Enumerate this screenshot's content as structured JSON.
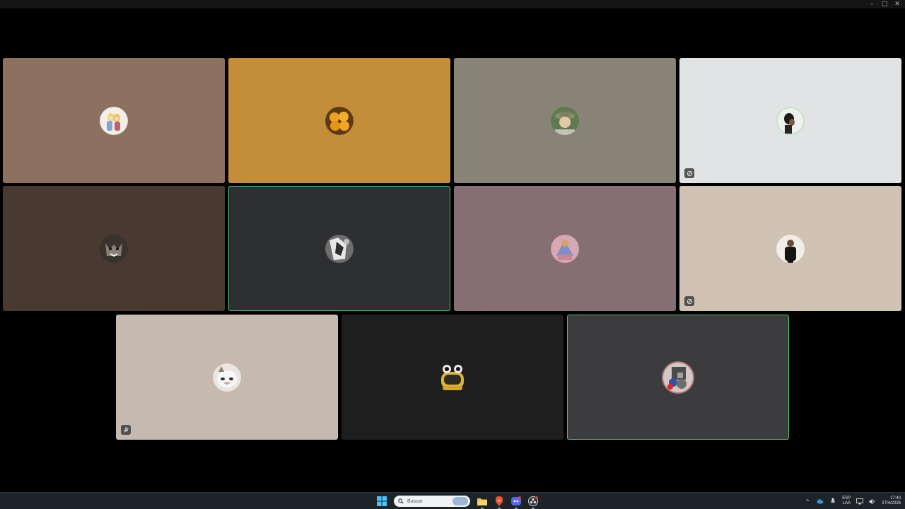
{
  "window": {
    "minimize_glyph": "–",
    "maximize_glyph": "□",
    "close_glyph": "✕"
  },
  "tiles": [
    {
      "bg": "#8c7161",
      "speaking": false,
      "avatar": "character-art"
    },
    {
      "bg": "#c48d3a",
      "speaking": false,
      "avatar": "oranges"
    },
    {
      "bg": "#878477",
      "speaking": false,
      "avatar": "person-hat"
    },
    {
      "bg": "#e2e3e4",
      "speaking": false,
      "avatar": "person-profile",
      "badge": "activity-icon"
    },
    {
      "bg": "#483a31",
      "speaking": false,
      "avatar": "wolf"
    },
    {
      "bg": "#2d2f32",
      "speaking": true,
      "avatar": "bw-animal"
    },
    {
      "bg": "#856f74",
      "speaking": false,
      "avatar": "pink-figure"
    },
    {
      "bg": "#d0c3b4",
      "speaking": false,
      "avatar": "person-dark-shirt",
      "badge": "activity-icon"
    },
    {
      "bg": "#c6bab0",
      "speaking": false,
      "avatar": "white-cat",
      "badge": "muted-mic-icon"
    },
    {
      "bg": "#1f1e1e",
      "speaking": false,
      "avatar": "yellow-frog"
    },
    {
      "bg": "#3c3c3f",
      "speaking": true,
      "avatar": "collage"
    }
  ],
  "taskbar": {
    "search_placeholder": "Buscar",
    "apps": [
      {
        "name": "start-button-icon"
      },
      {
        "name": "file-explorer-icon",
        "color": "#f0c44b"
      },
      {
        "name": "brave-browser-icon",
        "color": "#e8532c"
      },
      {
        "name": "discord-icon",
        "color": "#5865f2"
      },
      {
        "name": "obs-icon",
        "color": "#d9d9d9"
      }
    ],
    "lang_top": "ESP",
    "lang_bottom": "LAA",
    "time": "17:40",
    "date": "27/4/2026",
    "chevron_glyph": "^"
  }
}
